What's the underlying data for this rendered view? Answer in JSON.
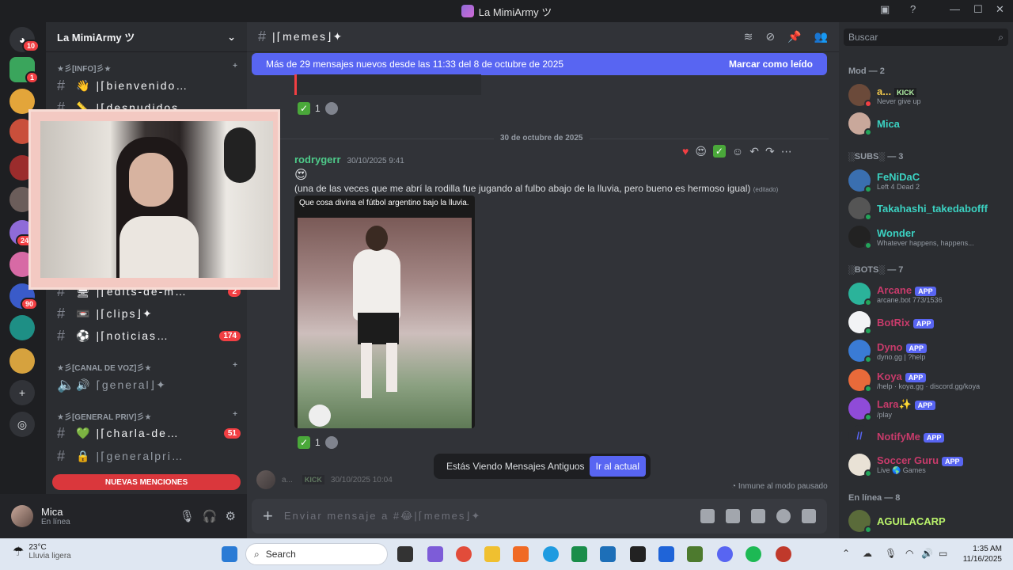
{
  "window": {
    "title": "La MimiArmy ツ"
  },
  "server_rail": {
    "badges": [
      "10",
      "1",
      "24",
      "90"
    ]
  },
  "server": {
    "name": "La MimiArmy ツ"
  },
  "categories": {
    "info": "★彡[INFO]彡★",
    "voice": "★彡[CANAL DE VOZ]彡★",
    "priv": "★彡[GENERAL PRIV]彡★"
  },
  "channels": [
    {
      "emoji": "👋",
      "name": "|⌈bienvenido…",
      "count": ""
    },
    {
      "emoji": "📏",
      "name": "|⌈desnudidos",
      "count": ""
    },
    {
      "emoji": "🖥",
      "name": "|⌈edits-de-m…",
      "count": "2"
    },
    {
      "emoji": "📼",
      "name": "|⌈clips⌋✦",
      "count": ""
    },
    {
      "emoji": "⚽",
      "name": "|⌈noticias…",
      "count": "174"
    }
  ],
  "voice_channel": {
    "emoji": "🔊",
    "name": "⌈general⌋✦"
  },
  "priv_channels": [
    {
      "emoji": "💚",
      "name": "|⌈charla-de…",
      "count": "51"
    },
    {
      "emoji": "🔒",
      "name": "|⌈generalpri…",
      "count": ""
    }
  ],
  "new_mentions": "NUEVAS MENCIONES",
  "user": {
    "name": "Mica",
    "status": "En línea"
  },
  "channel_header": {
    "name": "|⌈memes⌋✦"
  },
  "new_messages_bar": {
    "text": "Más de 29 mensajes nuevos desde las 11:33 del 8 de octubre de 2025",
    "action": "Marcar como leído"
  },
  "date_divider": "30 de octubre de 2025",
  "message": {
    "author": "rodrygerr",
    "timestamp": "30/10/2025 9:41",
    "emoji": "😍",
    "text": "(una de las veces que me abrí la rodilla fue jugando al fulbo abajo de la lluvia, pero bueno es hermoso igual)",
    "edited": "(editado)",
    "image_caption": "Que cosa divina el fútbol argentino bajo la lluvia."
  },
  "reactions": {
    "count_top": "1",
    "count_bottom": "1"
  },
  "next_message": {
    "author": "a...",
    "tag": "KICK",
    "timestamp": "30/10/2025 10:04"
  },
  "old_messages_banner": {
    "text": "Estás Viendo Mensajes Antiguos",
    "button": "Ir al actual"
  },
  "slowmode": "Inmune al modo pausado",
  "composer": {
    "placeholder": "Enviar mensaje a #😂|⌈memes⌋✦"
  },
  "members": {
    "search_placeholder": "Buscar",
    "mod_header": "Mod — 2",
    "mods": [
      {
        "name": "a...",
        "tag": "KICK",
        "sub": "Never give up",
        "color": "#f2c94c"
      },
      {
        "name": "Mica",
        "sub": "",
        "color": "#3bd1c1"
      }
    ],
    "subs_header": "░SUBS░ — 3",
    "subs": [
      {
        "name": "FeNiDaC",
        "sub": "Left 4 Dead 2",
        "color": "#3bd1c1"
      },
      {
        "name": "Takahashi_takedabofff",
        "sub": "",
        "color": "#3bd1c1"
      },
      {
        "name": "Wonder",
        "sub": "Whatever happens, happens...",
        "color": "#3bd1c1"
      }
    ],
    "bots_header": "░BOTS░ — 7",
    "bots": [
      {
        "name": "Arcane",
        "sub": "arcane.bot 773/1536",
        "tag": "APP"
      },
      {
        "name": "BotRix",
        "sub": "",
        "tag": "APP"
      },
      {
        "name": "Dyno",
        "sub": "dyno.gg | ?help",
        "tag": "APP"
      },
      {
        "name": "Koya",
        "sub": "/help · koya.gg · discord.gg/koya",
        "tag": "APP"
      },
      {
        "name": "Lara✨",
        "sub": "/play",
        "tag": "APP"
      },
      {
        "name": "NotifyMe",
        "sub": "",
        "tag": "APP"
      },
      {
        "name": "Soccer Guru",
        "sub": "Live 🌎 Games",
        "tag": "APP"
      }
    ],
    "online_header": "En línea — 8",
    "online": [
      {
        "name": "AGUILACARP"
      }
    ]
  },
  "taskbar": {
    "weather": {
      "temp": "23°C",
      "desc": "Lluvia ligera"
    },
    "search": "Search",
    "time": "1:35 AM",
    "date": "11/16/2025"
  },
  "colors": {
    "blurple": "#5865f2",
    "bot_name": "#c83b6b",
    "online": "#23a55a"
  }
}
